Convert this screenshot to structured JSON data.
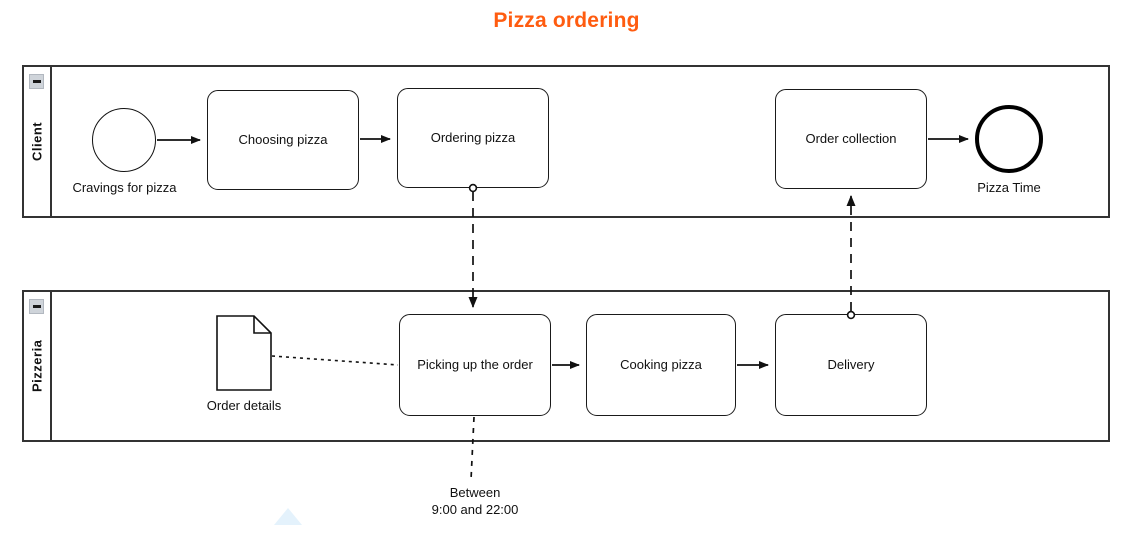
{
  "title": "Pizza ordering",
  "title_color": "#FF5C10",
  "pools": [
    {
      "id": "client",
      "label": "Client",
      "collapse_icon": "minus-icon"
    },
    {
      "id": "pizzeria",
      "label": "Pizzeria",
      "collapse_icon": "minus-icon"
    }
  ],
  "client_lane": {
    "start_event": {
      "type": "start-event",
      "label": "Cravings for pizza"
    },
    "tasks": [
      {
        "label": "Choosing pizza"
      },
      {
        "label": "Ordering pizza"
      },
      {
        "label": "Order collection"
      }
    ],
    "end_event": {
      "type": "end-event",
      "label": "Pizza Time"
    }
  },
  "pizzeria_lane": {
    "data_object": {
      "type": "data-object",
      "label": "Order details"
    },
    "tasks": [
      {
        "label": "Picking up the order"
      },
      {
        "label": "Cooking pizza"
      },
      {
        "label": "Delivery"
      }
    ]
  },
  "annotations": [
    {
      "line1": "Between",
      "line2": "9:00 and 22:00"
    }
  ],
  "flows": {
    "sequence_flow_style": "solid-arrow",
    "message_flow_style": "dashed-circle-arrow",
    "association_style": "dotted-line"
  }
}
